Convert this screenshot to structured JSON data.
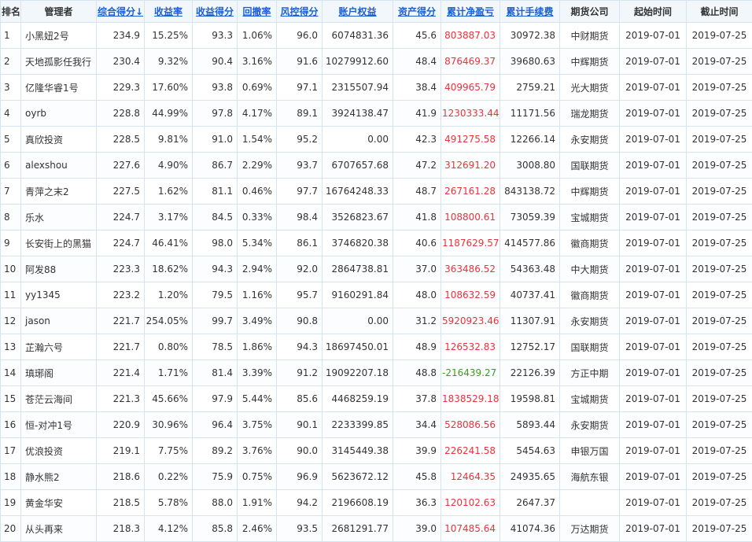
{
  "colors": {
    "positive": "#e8333a",
    "negative": "#3a9e1c",
    "link": "#1a5fd6",
    "border": "#d6e4f0",
    "header_bg": "#f2f7fc"
  },
  "headers": {
    "rank": "排名",
    "manager": "管理者",
    "composite": "综合得分↓",
    "return_rate": "收益率",
    "return_score": "收益得分",
    "drawdown": "回撤率",
    "risk_score": "风控得分",
    "equity": "账户权益",
    "asset_score": "资产得分",
    "net_profit": "累计净盈亏",
    "fees": "累计手续费",
    "broker": "期货公司",
    "start": "起始时间",
    "end": "截止时间"
  },
  "rows": [
    {
      "rank": "1",
      "manager": "小黑妞2号",
      "composite": "234.9",
      "return_rate": "15.25%",
      "return_score": "93.3",
      "drawdown": "1.06%",
      "risk_score": "96.0",
      "equity": "6074831.36",
      "asset_score": "45.6",
      "net_profit": "803887.03",
      "fees": "30972.38",
      "broker": "中财期货",
      "start": "2019-07-01",
      "end": "2019-07-25"
    },
    {
      "rank": "2",
      "manager": "天地孤影任我行",
      "composite": "230.4",
      "return_rate": "9.32%",
      "return_score": "90.4",
      "drawdown": "3.16%",
      "risk_score": "91.6",
      "equity": "10279912.60",
      "asset_score": "48.4",
      "net_profit": "876469.37",
      "fees": "39680.63",
      "broker": "中辉期货",
      "start": "2019-07-01",
      "end": "2019-07-25"
    },
    {
      "rank": "3",
      "manager": "亿隆华睿1号",
      "composite": "229.3",
      "return_rate": "17.60%",
      "return_score": "93.8",
      "drawdown": "0.69%",
      "risk_score": "97.1",
      "equity": "2315507.94",
      "asset_score": "38.4",
      "net_profit": "409965.79",
      "fees": "2759.21",
      "broker": "光大期货",
      "start": "2019-07-01",
      "end": "2019-07-25"
    },
    {
      "rank": "4",
      "manager": "oyrb",
      "composite": "228.8",
      "return_rate": "44.99%",
      "return_score": "97.8",
      "drawdown": "4.17%",
      "risk_score": "89.1",
      "equity": "3924138.47",
      "asset_score": "41.9",
      "net_profit": "1230333.44",
      "fees": "11171.56",
      "broker": "瑞龙期货",
      "start": "2019-07-01",
      "end": "2019-07-25"
    },
    {
      "rank": "5",
      "manager": "真欣投资",
      "composite": "228.5",
      "return_rate": "9.81%",
      "return_score": "91.0",
      "drawdown": "1.54%",
      "risk_score": "95.2",
      "equity": "0.00",
      "asset_score": "42.3",
      "net_profit": "491275.58",
      "fees": "12266.14",
      "broker": "永安期货",
      "start": "2019-07-01",
      "end": "2019-07-25"
    },
    {
      "rank": "6",
      "manager": "alexshou",
      "composite": "227.6",
      "return_rate": "4.90%",
      "return_score": "86.7",
      "drawdown": "2.29%",
      "risk_score": "93.7",
      "equity": "6707657.68",
      "asset_score": "47.2",
      "net_profit": "312691.20",
      "fees": "3008.80",
      "broker": "国联期货",
      "start": "2019-07-01",
      "end": "2019-07-25"
    },
    {
      "rank": "7",
      "manager": "青萍之末2",
      "composite": "227.5",
      "return_rate": "1.62%",
      "return_score": "81.1",
      "drawdown": "0.46%",
      "risk_score": "97.7",
      "equity": "16764248.33",
      "asset_score": "48.7",
      "net_profit": "267161.28",
      "fees": "843138.72",
      "broker": "中辉期货",
      "start": "2019-07-01",
      "end": "2019-07-25"
    },
    {
      "rank": "8",
      "manager": "乐水",
      "composite": "224.7",
      "return_rate": "3.17%",
      "return_score": "84.5",
      "drawdown": "0.33%",
      "risk_score": "98.4",
      "equity": "3526823.67",
      "asset_score": "41.8",
      "net_profit": "108800.61",
      "fees": "73059.39",
      "broker": "宝城期货",
      "start": "2019-07-01",
      "end": "2019-07-25"
    },
    {
      "rank": "9",
      "manager": "长安街上的黑猫",
      "composite": "224.7",
      "return_rate": "46.41%",
      "return_score": "98.0",
      "drawdown": "5.34%",
      "risk_score": "86.1",
      "equity": "3746820.38",
      "asset_score": "40.6",
      "net_profit": "1187629.57",
      "fees": "414577.86",
      "broker": "徽商期货",
      "start": "2019-07-01",
      "end": "2019-07-25"
    },
    {
      "rank": "10",
      "manager": "阿发88",
      "composite": "223.3",
      "return_rate": "18.62%",
      "return_score": "94.3",
      "drawdown": "2.94%",
      "risk_score": "92.0",
      "equity": "2864738.81",
      "asset_score": "37.0",
      "net_profit": "363486.52",
      "fees": "54363.48",
      "broker": "中大期货",
      "start": "2019-07-01",
      "end": "2019-07-25"
    },
    {
      "rank": "11",
      "manager": "yy1345",
      "composite": "223.2",
      "return_rate": "1.20%",
      "return_score": "79.5",
      "drawdown": "1.16%",
      "risk_score": "95.7",
      "equity": "9160291.84",
      "asset_score": "48.0",
      "net_profit": "108632.59",
      "fees": "40737.41",
      "broker": "徽商期货",
      "start": "2019-07-01",
      "end": "2019-07-25"
    },
    {
      "rank": "12",
      "manager": "jason",
      "composite": "221.7",
      "return_rate": "254.05%",
      "return_score": "99.7",
      "drawdown": "3.49%",
      "risk_score": "90.8",
      "equity": "0.00",
      "asset_score": "31.2",
      "net_profit": "5920923.46",
      "fees": "11307.91",
      "broker": "永安期货",
      "start": "2019-07-01",
      "end": "2019-07-25"
    },
    {
      "rank": "13",
      "manager": "芷瀚六号",
      "composite": "221.7",
      "return_rate": "0.80%",
      "return_score": "78.5",
      "drawdown": "1.86%",
      "risk_score": "94.3",
      "equity": "18697450.01",
      "asset_score": "48.9",
      "net_profit": "126532.83",
      "fees": "12752.17",
      "broker": "国联期货",
      "start": "2019-07-01",
      "end": "2019-07-25"
    },
    {
      "rank": "14",
      "manager": "瑱琊阁",
      "composite": "221.4",
      "return_rate": "1.71%",
      "return_score": "81.4",
      "drawdown": "3.39%",
      "risk_score": "91.2",
      "equity": "19092207.18",
      "asset_score": "48.8",
      "net_profit": "-216439.27",
      "fees": "22126.39",
      "broker": "方正中期",
      "start": "2019-07-01",
      "end": "2019-07-25"
    },
    {
      "rank": "15",
      "manager": "苍茫云海间",
      "composite": "221.3",
      "return_rate": "45.66%",
      "return_score": "97.9",
      "drawdown": "5.44%",
      "risk_score": "85.6",
      "equity": "4468259.19",
      "asset_score": "37.8",
      "net_profit": "1838529.18",
      "fees": "19598.81",
      "broker": "宝城期货",
      "start": "2019-07-01",
      "end": "2019-07-25"
    },
    {
      "rank": "16",
      "manager": "恒-对冲1号",
      "composite": "220.9",
      "return_rate": "30.96%",
      "return_score": "96.4",
      "drawdown": "3.75%",
      "risk_score": "90.1",
      "equity": "2233399.85",
      "asset_score": "34.4",
      "net_profit": "528086.56",
      "fees": "5893.44",
      "broker": "永安期货",
      "start": "2019-07-01",
      "end": "2019-07-25"
    },
    {
      "rank": "17",
      "manager": "优浪投资",
      "composite": "219.1",
      "return_rate": "7.75%",
      "return_score": "89.2",
      "drawdown": "3.76%",
      "risk_score": "90.0",
      "equity": "3145449.38",
      "asset_score": "39.9",
      "net_profit": "226241.58",
      "fees": "5454.63",
      "broker": "申银万国",
      "start": "2019-07-01",
      "end": "2019-07-25"
    },
    {
      "rank": "18",
      "manager": "静水熊2",
      "composite": "218.6",
      "return_rate": "0.22%",
      "return_score": "75.9",
      "drawdown": "0.75%",
      "risk_score": "96.9",
      "equity": "5623672.12",
      "asset_score": "45.8",
      "net_profit": "12464.35",
      "fees": "24935.65",
      "broker": "海航东银",
      "start": "2019-07-01",
      "end": "2019-07-25"
    },
    {
      "rank": "19",
      "manager": "黄金华安",
      "composite": "218.5",
      "return_rate": "5.78%",
      "return_score": "88.0",
      "drawdown": "1.91%",
      "risk_score": "94.2",
      "equity": "2196608.19",
      "asset_score": "36.3",
      "net_profit": "120102.63",
      "fees": "2647.37",
      "broker": "",
      "start": "2019-07-01",
      "end": "2019-07-25"
    },
    {
      "rank": "20",
      "manager": "从头再来",
      "composite": "218.3",
      "return_rate": "4.12%",
      "return_score": "85.8",
      "drawdown": "2.46%",
      "risk_score": "93.5",
      "equity": "2681291.77",
      "asset_score": "39.0",
      "net_profit": "107485.64",
      "fees": "41074.36",
      "broker": "万达期货",
      "start": "2019-07-01",
      "end": "2019-07-25"
    }
  ]
}
